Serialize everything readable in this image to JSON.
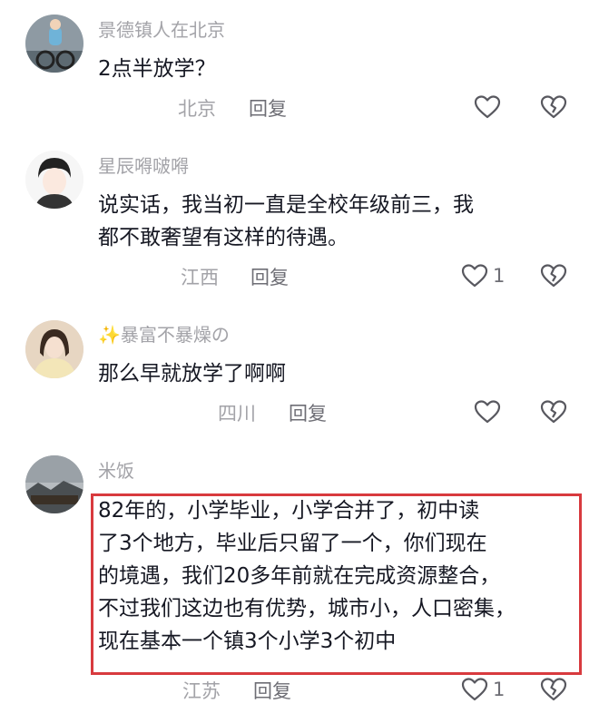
{
  "comments": [
    {
      "username": "景德镇人在北京",
      "lines": [
        "2点半放学？"
      ],
      "location": "北京",
      "reply": "回复",
      "likes": ""
    },
    {
      "username": "星辰嘚啵嘚",
      "lines": [
        "说实话，我当初一直是全校年级前三，我",
        "都不敢奢望有这样的待遇。"
      ],
      "location": "江西",
      "reply": "回复",
      "likes": "1"
    },
    {
      "username": "✨暴富不暴燥の",
      "lines": [
        "那么早就放学了啊啊"
      ],
      "location": "四川",
      "reply": "回复",
      "likes": ""
    },
    {
      "username": "米饭",
      "lines": [
        "82年的，小学毕业，小学合并了，初中读",
        "了3个地方，毕业后只留了一个，你们现在",
        "的境遇，我们20多年前就在完成资源整合，",
        "不过我们这边也有优势，城市小，人口密集，",
        "现在基本一个镇3个小学3个初中"
      ],
      "location": "江苏",
      "reply": "回复",
      "likes": "1"
    }
  ],
  "icons": {
    "like": "heart-outline-icon",
    "dislike": "broken-heart-icon"
  },
  "colors": {
    "highlight": "#d83a3e",
    "username": "#a3a3a8",
    "text": "#161823"
  }
}
